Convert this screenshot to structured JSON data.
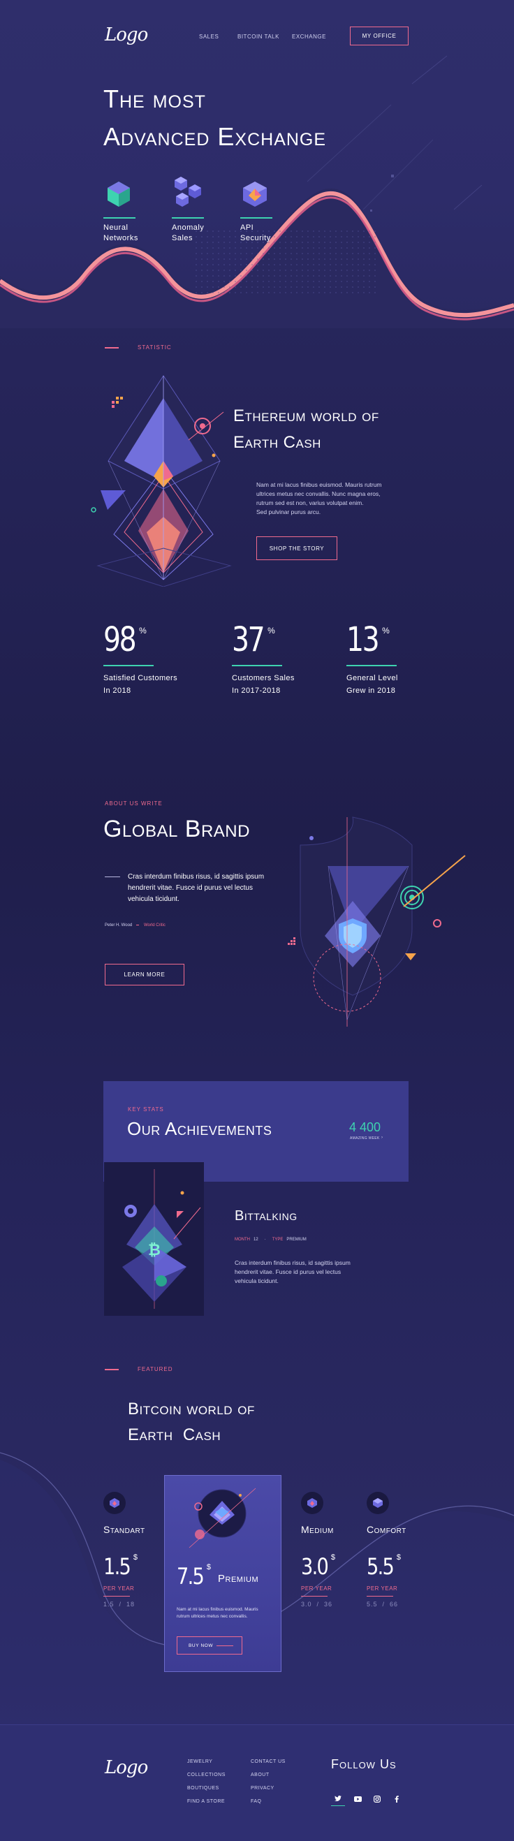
{
  "nav": {
    "logo": "Logo",
    "links": [
      "SALES",
      "BITCOIN TALK",
      "EXCHANGE"
    ],
    "cta": "MY OFFICE"
  },
  "hero": {
    "title_line1": "The most",
    "title_line2": "Advanced Exchange",
    "features": [
      {
        "line1": "Neural",
        "line2": "Networks",
        "icon": "cube-icon"
      },
      {
        "line1": "Anomaly",
        "line2": "Sales",
        "icon": "cubes-icon"
      },
      {
        "line1": "API",
        "line2": "Security",
        "icon": "gem-cube-icon"
      }
    ]
  },
  "statistic": {
    "tag": "STATISTIC",
    "title_line1": "Ethereum world of",
    "title_line2": "Earth Cash",
    "paragraph": [
      "Nam at mi lacus finibus euismod. Mauris rutrum",
      "ultrices metus nec convallis. Nunc magna eros,",
      "rutrum sed est non, varius volutpat enim.",
      "Sed pulvinar purus arcu."
    ],
    "cta": "SHOP THE STORY"
  },
  "stats": [
    {
      "value": "98",
      "unit": "%",
      "line1": "Satisfied Customers",
      "line2": "In 2018"
    },
    {
      "value": "37",
      "unit": "%",
      "line1": "Customers Sales",
      "line2": "In 2017-2018"
    },
    {
      "value": "13",
      "unit": "%",
      "line1": "General Level",
      "line2": "Grew in 2018"
    }
  ],
  "about": {
    "tag": "ABOUT US WRITE",
    "title": "Global Brand",
    "quote": [
      "Cras interdum finibus risus, id sagittis ipsum",
      "hendrerit vitae. Fusce id purus vel lectus",
      "vehicula ticidunt."
    ],
    "author": "Peter H. Wood",
    "source": "World Critic",
    "cta": "LEARN MORE"
  },
  "achievements": {
    "tag": "KEY STATS",
    "title": "Our Achievements",
    "count": "4 400",
    "count_label": "AMAZING WEEK",
    "card_title": "Bittalking",
    "meta_label1": "MONTH",
    "meta_value1": "12",
    "meta_label2": "TYPE",
    "meta_value2": "PREMIUM",
    "paragraph": [
      "Cras interdum finibus risus, id sagittis ipsum",
      "hendrerit vitae. Fusce id purus vel lectus",
      "vehicula ticidunt."
    ]
  },
  "featured": {
    "tag": "FEATURED",
    "title_line1": "Bitcoin world of",
    "title_line2": "Earth  Cash",
    "plans": [
      {
        "name": "Standart",
        "price": "1.5",
        "unit": "$",
        "per": "PER YEAR",
        "from": "1.5",
        "to": "18"
      },
      {
        "name": "Premium",
        "price": "7.5",
        "unit": "$",
        "per": "",
        "from": "",
        "to": ""
      },
      {
        "name": "Medium",
        "price": "3.0",
        "unit": "$",
        "per": "PER YEAR",
        "from": "3.0",
        "to": "36"
      },
      {
        "name": "Comfort",
        "price": "5.5",
        "unit": "$",
        "per": "PER YEAR",
        "from": "5.5",
        "to": "66"
      }
    ],
    "premium_paragraph": [
      "Nam at mi lacus finibus euismod. Mauris",
      "rutrum ultrices metus nec convallis."
    ],
    "premium_cta": "BUY NOW"
  },
  "footer": {
    "logo": "Logo",
    "col1": [
      "JEWELRY",
      "COLLECTIONS",
      "BOUTIQUES",
      "FIND A STORE"
    ],
    "col2": [
      "CONTACT US",
      "ABOUT",
      "PRIVACY",
      "FAQ"
    ],
    "follow": "Follow Us",
    "social": [
      "twitter-icon",
      "youtube-icon",
      "instagram-icon",
      "facebook-icon"
    ]
  },
  "colors": {
    "accent": "#f06b8e",
    "teal": "#3ed3b0",
    "bg": "#26255a",
    "panel": "#3b3b8c"
  }
}
